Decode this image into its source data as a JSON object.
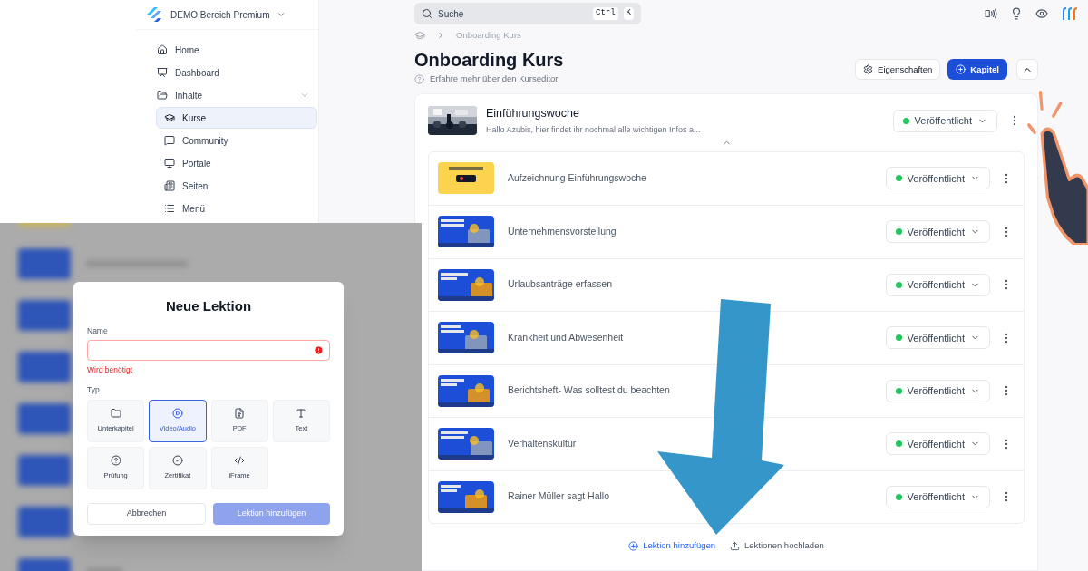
{
  "workspace": {
    "name": "DEMO Bereich Premium"
  },
  "sidebar": {
    "items": [
      {
        "label": "Home",
        "selected": false
      },
      {
        "label": "Dashboard",
        "selected": false
      },
      {
        "label": "Inhalte",
        "selected": false,
        "expanded": true,
        "children": [
          {
            "label": "Kurse",
            "selected": true
          },
          {
            "label": "Community",
            "selected": false
          },
          {
            "label": "Portale",
            "selected": false
          },
          {
            "label": "Seiten",
            "selected": false
          },
          {
            "label": "Menü",
            "selected": false
          }
        ]
      }
    ]
  },
  "search": {
    "placeholder": "Suche",
    "shortcut": [
      "Ctrl",
      "K"
    ]
  },
  "breadcrumb": [
    "Onboarding Kurs"
  ],
  "page": {
    "title": "Onboarding Kurs",
    "help": "Erfahre mehr über den Kurseditor"
  },
  "actions": {
    "properties": "Eigenschaften",
    "add_chapter": "Kapitel",
    "collapsed": false
  },
  "chapter": {
    "title": "Einführungswoche",
    "description": "Hallo Azubis, hier findet ihr nochmal alle wichtigen Infos a...",
    "status": "Veröffentlicht",
    "expanded": true,
    "lessons": [
      {
        "title": "Aufzeichnung Einführungswoche",
        "status": "Veröffentlicht"
      },
      {
        "title": "Unternehmensvorstellung",
        "status": "Veröffentlicht"
      },
      {
        "title": "Urlaubsanträge erfassen",
        "status": "Veröffentlicht"
      },
      {
        "title": "Krankheit und Abwesenheit",
        "status": "Veröffentlicht"
      },
      {
        "title": "Berichtsheft- Was solltest du beachten",
        "status": "Veröffentlicht"
      },
      {
        "title": "Verhaltenskultur",
        "status": "Veröffentlicht"
      },
      {
        "title": "Rainer Müller sagt Hallo",
        "status": "Veröffentlicht"
      }
    ]
  },
  "footer_actions": [
    "Lektion hinzufügen",
    "Lektionen hochladen"
  ],
  "dialog": {
    "title": "Neue Lektion",
    "name_label": "Name",
    "name_invalid": true,
    "name_error": "Wird benötigt",
    "type_label": "Typ",
    "types": [
      {
        "label": "Unterkapitel",
        "selected": false
      },
      {
        "label": "Video/Audio",
        "selected": true
      },
      {
        "label": "PDF",
        "selected": false
      },
      {
        "label": "Text",
        "selected": false
      },
      {
        "label": "Prüfung",
        "selected": false
      },
      {
        "label": "Zertifikat",
        "selected": false
      },
      {
        "label": "iFrame",
        "selected": false
      }
    ],
    "cancel": "Abbrechen",
    "submit": "Lektion hinzufügen",
    "submit_disabled": true
  }
}
